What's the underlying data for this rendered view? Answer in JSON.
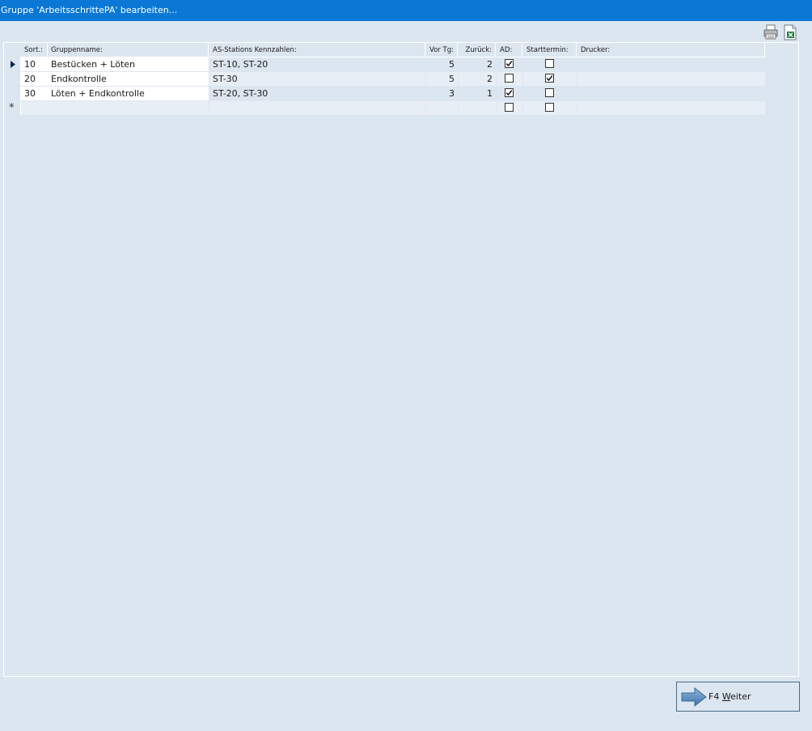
{
  "window": {
    "title": "Gruppe 'ArbeitsschrittePA' bearbeiten..."
  },
  "toolbar": {
    "print_icon": "printer-icon",
    "export_icon": "excel-export-icon"
  },
  "grid": {
    "columns": [
      "Sort.:",
      "Gruppenname:",
      "AS-Stations Kennzahlen:",
      "Vor Tg:",
      "Zurück:",
      "AD:",
      "Starttermin:",
      "Drucker:"
    ],
    "rows": [
      {
        "sort": "10",
        "name": "Bestücken + Löten",
        "stations": "ST-10, ST-20",
        "vor": "5",
        "zurueck": "2",
        "ad": true,
        "start": false,
        "drucker": ""
      },
      {
        "sort": "20",
        "name": "Endkontrolle",
        "stations": "ST-30",
        "vor": "5",
        "zurueck": "2",
        "ad": false,
        "start": true,
        "drucker": ""
      },
      {
        "sort": "30",
        "name": "Löten + Endkontrolle",
        "stations": "ST-20, ST-30",
        "vor": "3",
        "zurueck": "1",
        "ad": true,
        "start": false,
        "drucker": ""
      }
    ],
    "new_row_marker": "*"
  },
  "footer": {
    "next_key": "F4",
    "next_mnemonic": "W",
    "next_rest": "eiter"
  }
}
